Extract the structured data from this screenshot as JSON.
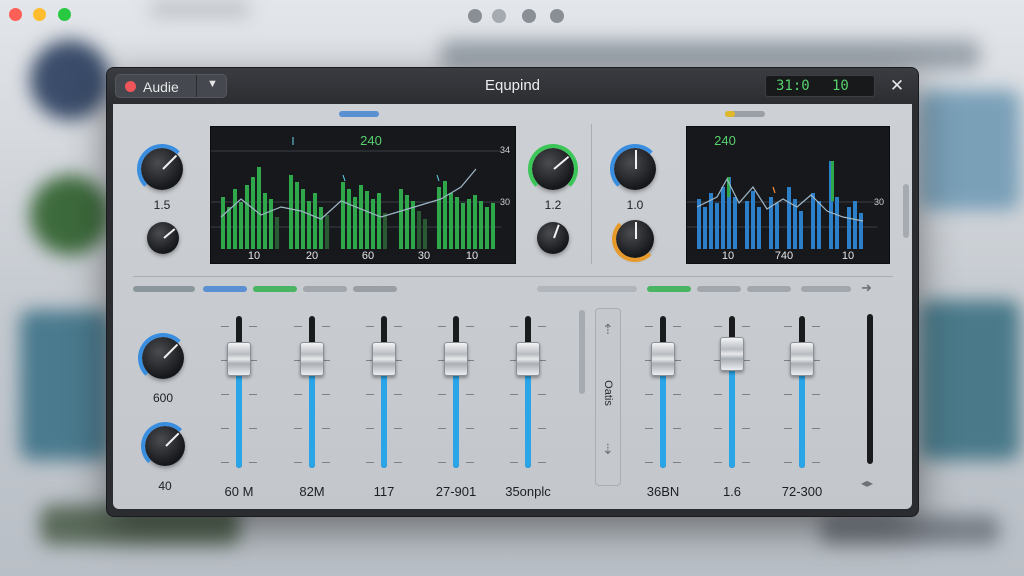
{
  "source_button": {
    "label": "Audie",
    "caret": "▼"
  },
  "window_title": "Equpind",
  "time_display": {
    "left": "31:0",
    "right": "10"
  },
  "close_icon": "✕",
  "knobs_left": {
    "top_value": "1.5",
    "mid_value": "1.2",
    "right_value": "1.0"
  },
  "screen_left": {
    "peak_label": "240",
    "x_ticks": [
      "10",
      "20",
      "60",
      "30",
      "10"
    ],
    "y_ticks": [
      "34",
      "30"
    ]
  },
  "screen_right": {
    "peak_label": "240",
    "x_ticks": [
      "10",
      "740",
      "10"
    ],
    "y_ticks": [
      "30"
    ]
  },
  "fader_section": {
    "knob_values": [
      "600",
      "40"
    ],
    "labels": [
      "60 M",
      "82M",
      "117",
      "27-901",
      "35onplc",
      "36BN",
      "1.6",
      "72-300"
    ],
    "side_label": "Oatis",
    "levels": [
      0.72,
      0.72,
      0.72,
      0.72,
      0.72,
      0.72,
      0.75,
      0.72
    ]
  },
  "colors": {
    "accent_blue": "#2aa5e8",
    "accent_green": "#3cc658",
    "knob_orange": "#e79a2a"
  }
}
